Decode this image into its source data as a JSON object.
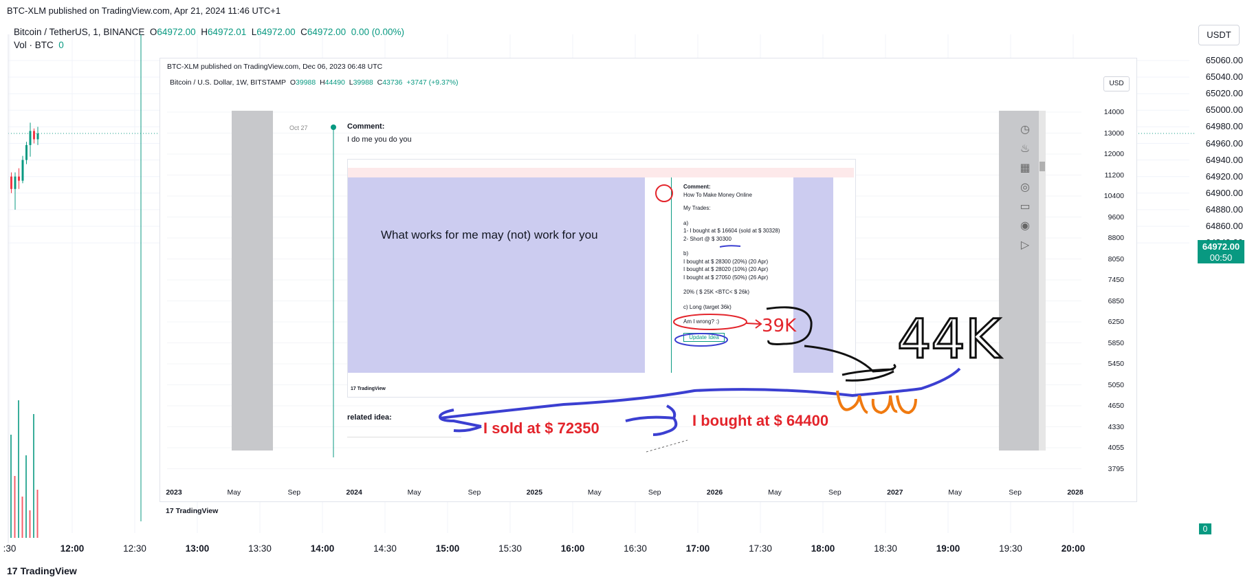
{
  "header": {
    "published": "BTC-XLM published on TradingView.com, Apr 21, 2024 11:46 UTC+1"
  },
  "symbol": {
    "name": "Bitcoin / TetherUS, 1, BINANCE",
    "o_label": "O",
    "o": "64972.00",
    "h_label": "H",
    "h": "64972.01",
    "l_label": "L",
    "l": "64972.00",
    "c_label": "C",
    "c": "64972.00",
    "change": "0.00 (0.00%)",
    "vol_label": "Vol · BTC",
    "vol": "0"
  },
  "currency_button": "USDT",
  "last_price": {
    "price": "64972.00",
    "countdown": "00:50"
  },
  "volume_tag": "0",
  "footer": {
    "logo": "17",
    "brand": "TradingView"
  },
  "colors": {
    "up": "#089981",
    "down": "#f23645",
    "accent": "#089981",
    "purple_fill": "#ccccf0",
    "pen_blue": "#3b3fd1",
    "pen_orange": "#f07a10",
    "pen_red": "#e3242b"
  },
  "chart_data": {
    "type": "line",
    "title": "",
    "y_axis": {
      "ticks": [
        "65060.00",
        "65040.00",
        "65020.00",
        "65000.00",
        "64980.00",
        "64960.00",
        "64940.00",
        "64920.00",
        "64900.00",
        "64880.00",
        "64860.00",
        "64840.00"
      ],
      "range": [
        64836,
        65066
      ]
    },
    "x_axis": {
      "ticks": [
        ":30",
        "12:00",
        "12:30",
        "13:00",
        "13:30",
        "14:00",
        "14:30",
        "15:00",
        "15:30",
        "16:00",
        "16:30",
        "17:00",
        "17:30",
        "18:00",
        "18:30",
        "19:00",
        "19:30",
        "20:00"
      ],
      "bold": [
        "12:00",
        "13:00",
        "14:00",
        "15:00",
        "16:00",
        "17:00",
        "18:00",
        "19:00",
        "20:00"
      ]
    },
    "last_value": 64972.0,
    "grid": true,
    "candles": [
      {
        "o": 64920,
        "h": 64925,
        "l": 64900,
        "c": 64905
      },
      {
        "o": 64905,
        "h": 64925,
        "l": 64880,
        "c": 64920
      },
      {
        "o": 64920,
        "h": 64930,
        "l": 64905,
        "c": 64915
      },
      {
        "o": 64915,
        "h": 64945,
        "l": 64912,
        "c": 64940
      },
      {
        "o": 64940,
        "h": 64962,
        "l": 64935,
        "c": 64958
      },
      {
        "o": 64958,
        "h": 64985,
        "l": 64944,
        "c": 64975
      },
      {
        "o": 64975,
        "h": 64978,
        "l": 64960,
        "c": 64965
      },
      {
        "o": 64965,
        "h": 64980,
        "l": 64958,
        "c": 64972
      }
    ]
  },
  "inner_chart": {
    "published": "BTC-XLM published on TradingView.com, Dec 06, 2023 06:48 UTC",
    "symbol": "Bitcoin / U.S. Dollar, 1W, BITSTAMP",
    "o_label": "O",
    "o": "39988",
    "h_label": "H",
    "h": "44490",
    "l_label": "L",
    "l": "39988",
    "c_label": "C",
    "c": "43736",
    "change": "+3747 (+9.37%)",
    "currency": "USD",
    "y_ticks": [
      "14000",
      "13000",
      "12000",
      "11200",
      "10400",
      "9600",
      "8800",
      "8050",
      "7450",
      "6850",
      "6250",
      "5850",
      "5450",
      "5050",
      "4650",
      "4330",
      "4055",
      "3795"
    ],
    "x_ticks": [
      "2023",
      "May",
      "Sep",
      "2024",
      "May",
      "Sep",
      "2025",
      "May",
      "Sep",
      "2026",
      "May",
      "Sep",
      "2027",
      "May",
      "Sep",
      "2028"
    ],
    "x_bold": [
      "2023",
      "2024",
      "2025",
      "2026",
      "2027",
      "2028"
    ],
    "comment_date": "Oct 27",
    "comment_title": "Comment:",
    "comment_text": "I do me you do you",
    "related": "related idea:",
    "watermark": "TradingView",
    "nested_text": "What works for me may (not) work for you",
    "nested_comment": {
      "title": "Comment:",
      "subtitle": "How To Make Money Online",
      "trades": "My Trades:",
      "a": "a)",
      "a1": "1- I bought at $ 16604 (sold at $ 30328)",
      "a2": "2- Short @ $ 30300",
      "b": "b)",
      "b1": "I bought at $ 28300 (20%) (20 Apr)",
      "b2": "I bought at $ 28020 (10%) (20 Apr)",
      "b3": "I bought at $ 27050 (50%) (26 Apr)",
      "range": "20% ( $ 25K <BTC< $ 26k)",
      "c": "c) Long (target 36k)",
      "wrong": "Am I wrong? :)",
      "update": "Update Idea"
    }
  },
  "annotations": {
    "sold": "I sold  at $ 72350",
    "bought": "I bought at $ 64400",
    "handwritten_39k": "39K",
    "handwritten_44k": "44K"
  }
}
